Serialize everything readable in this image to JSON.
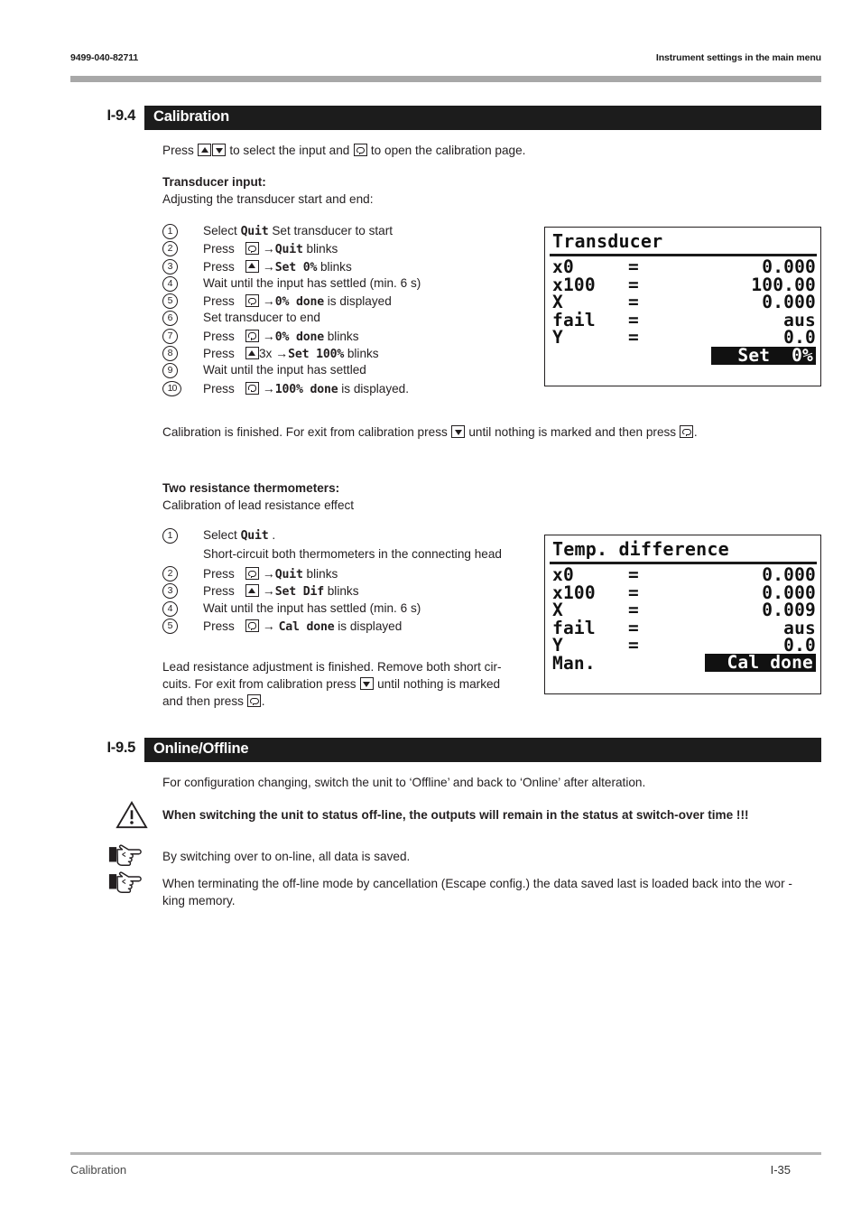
{
  "header": {
    "doc_number": "9499-040-82711",
    "chapter_title": "Instrument settings in the main menu"
  },
  "sections": [
    {
      "number": "I-9.4",
      "title": "Calibration"
    },
    {
      "number": "I-9.5",
      "title": "Online/Offline"
    }
  ],
  "calibration": {
    "intro_pre": "Press",
    "intro_mid": "to select the input and",
    "intro_post": "to open the calibration page.",
    "transducer": {
      "heading": "Transducer input:",
      "subheading": "Adjusting the transducer start and end:",
      "steps": [
        {
          "num": "1",
          "press": "Select",
          "key": "none",
          "arrow": "",
          "code": "Quit",
          "tail": "Set transducer to start"
        },
        {
          "num": "2",
          "press": "Press",
          "key": "enter",
          "arrow": "→",
          "code": "Quit",
          "tail": "blinks"
        },
        {
          "num": "3",
          "press": "Press",
          "key": "up",
          "arrow": "→",
          "code": "Set 0%",
          "tail": "blinks"
        },
        {
          "num": "4",
          "press": "Wait until the input has settled (min. 6 s)",
          "key": "none",
          "arrow": "",
          "code": "",
          "tail": ""
        },
        {
          "num": "5",
          "press": "Press",
          "key": "enter",
          "arrow": "→",
          "code": "0% done",
          "tail": "is displayed"
        },
        {
          "num": "6",
          "press": "Set transducer to end",
          "key": "none",
          "arrow": "",
          "code": "",
          "tail": ""
        },
        {
          "num": "7",
          "press": "Press",
          "key": "enter",
          "arrow": "→",
          "code": "0% done",
          "tail": "blinks"
        },
        {
          "num": "8",
          "press": "Press",
          "key": "up",
          "mult": "3x",
          "arrow": "→",
          "code": "Set 100%",
          "tail": "blinks"
        },
        {
          "num": "9",
          "press": "Wait until the input has settled",
          "key": "none",
          "arrow": "",
          "code": "",
          "tail": ""
        },
        {
          "num": "10",
          "press": "Press",
          "key": "enter",
          "arrow": "→",
          "code": "100% done",
          "tail": "is displayed."
        }
      ],
      "closing_a": "Calibration is finished. For exit from calibration press",
      "closing_b": "until nothing is marked and then press",
      "closing_c": "."
    },
    "thermometers": {
      "heading": "Two resistance thermometers:",
      "subheading": "Calibration of lead resistance effect",
      "steps": [
        {
          "num": "1",
          "press": "Select",
          "key": "none",
          "arrow": "",
          "code": "Quit",
          "tail": ".",
          "extra": "Short-circuit both thermometers in the connecting head"
        },
        {
          "num": "2",
          "press": "Press",
          "key": "enter",
          "arrow": "→",
          "code": "Quit",
          "tail": "blinks"
        },
        {
          "num": "3",
          "press": "Press",
          "key": "up",
          "arrow": "→",
          "code": "Set Dif",
          "tail": "blinks"
        },
        {
          "num": "4",
          "press": "Wait until the input has settled (min. 6 s)",
          "key": "none",
          "arrow": "",
          "code": "",
          "tail": ""
        },
        {
          "num": "5",
          "press": "Press",
          "key": "enter",
          "arrow": "→",
          "code": "Cal done",
          "tail": "is displayed"
        }
      ],
      "closing_a": "Lead resistance adjustment is finished. Remove both short cir-",
      "closing_b": "cuits. For exit from calibration press",
      "closing_c": "until nothing is marked",
      "closing_d": "and then press",
      "closing_e": "."
    }
  },
  "lcd_transducer": {
    "title": "Transducer",
    "rows": [
      {
        "label": "x0",
        "eq": "=",
        "value": "0.000"
      },
      {
        "label": "x100",
        "eq": "=",
        "value": "100.00"
      },
      {
        "label": "X",
        "eq": "=",
        "value": "0.000"
      },
      {
        "label": "fail",
        "eq": "=",
        "value": "aus"
      },
      {
        "label": "Y",
        "eq": "=",
        "value": "0.0"
      }
    ],
    "highlight": "Set  0%"
  },
  "lcd_tempdiff": {
    "title": "Temp. difference",
    "rows": [
      {
        "label": "x0",
        "eq": "=",
        "value": "0.000"
      },
      {
        "label": "x100",
        "eq": "=",
        "value": "0.000"
      },
      {
        "label": "X",
        "eq": "=",
        "value": "0.009"
      },
      {
        "label": "fail",
        "eq": "=",
        "value": "aus"
      },
      {
        "label": "Y",
        "eq": "=",
        "value": "0.0"
      },
      {
        "label": "Man.",
        "eq": "",
        "value": ""
      }
    ],
    "highlight": "Cal done"
  },
  "online_offline": {
    "intro": "For configuration changing, switch the unit to ‘Offline’ and back to ‘Online’ after alteration.",
    "warning": "When switching the unit to status off-line, the outputs will remain in the status at switch-over time !!!",
    "note1": "By switching over to on-line, all data is saved.",
    "note2_line1": "When terminating the off-line mode by cancellation  (Escape config.) the data saved last is loaded back into the wor -",
    "note2_line2": "king memory."
  },
  "footer": {
    "left": "Calibration",
    "right": "I-35"
  },
  "colors": {
    "section_bar": "#1c1c1c",
    "header_rule": "#a8a8a8",
    "footer_rule": "#b4b4b4",
    "text": "#231f20"
  }
}
